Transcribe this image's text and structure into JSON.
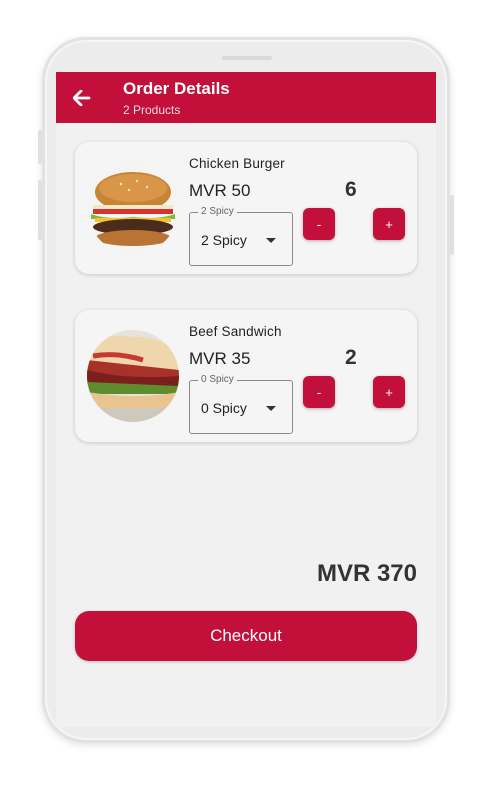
{
  "appbar": {
    "title": "Order Details",
    "subtitle": "2 Products",
    "back_icon": "arrow-left-icon"
  },
  "items": [
    {
      "name": "Chicken Burger",
      "price": "MVR 50",
      "quantity": "6",
      "spicy_label": "2 Spicy",
      "spicy_value": "2 Spicy",
      "minus_label": "-",
      "plus_label": "+",
      "image": "chicken-burger-photo"
    },
    {
      "name": "Beef Sandwich",
      "price": "MVR 35",
      "quantity": "2",
      "spicy_label": "0 Spicy",
      "spicy_value": "0 Spicy",
      "minus_label": "-",
      "plus_label": "+",
      "image": "beef-sandwich-photo"
    }
  ],
  "total": "MVR 370",
  "checkout_label": "Checkout",
  "colors": {
    "brand": "#c2103b",
    "background": "#f1f1f1",
    "card": "#f5f5f5"
  }
}
